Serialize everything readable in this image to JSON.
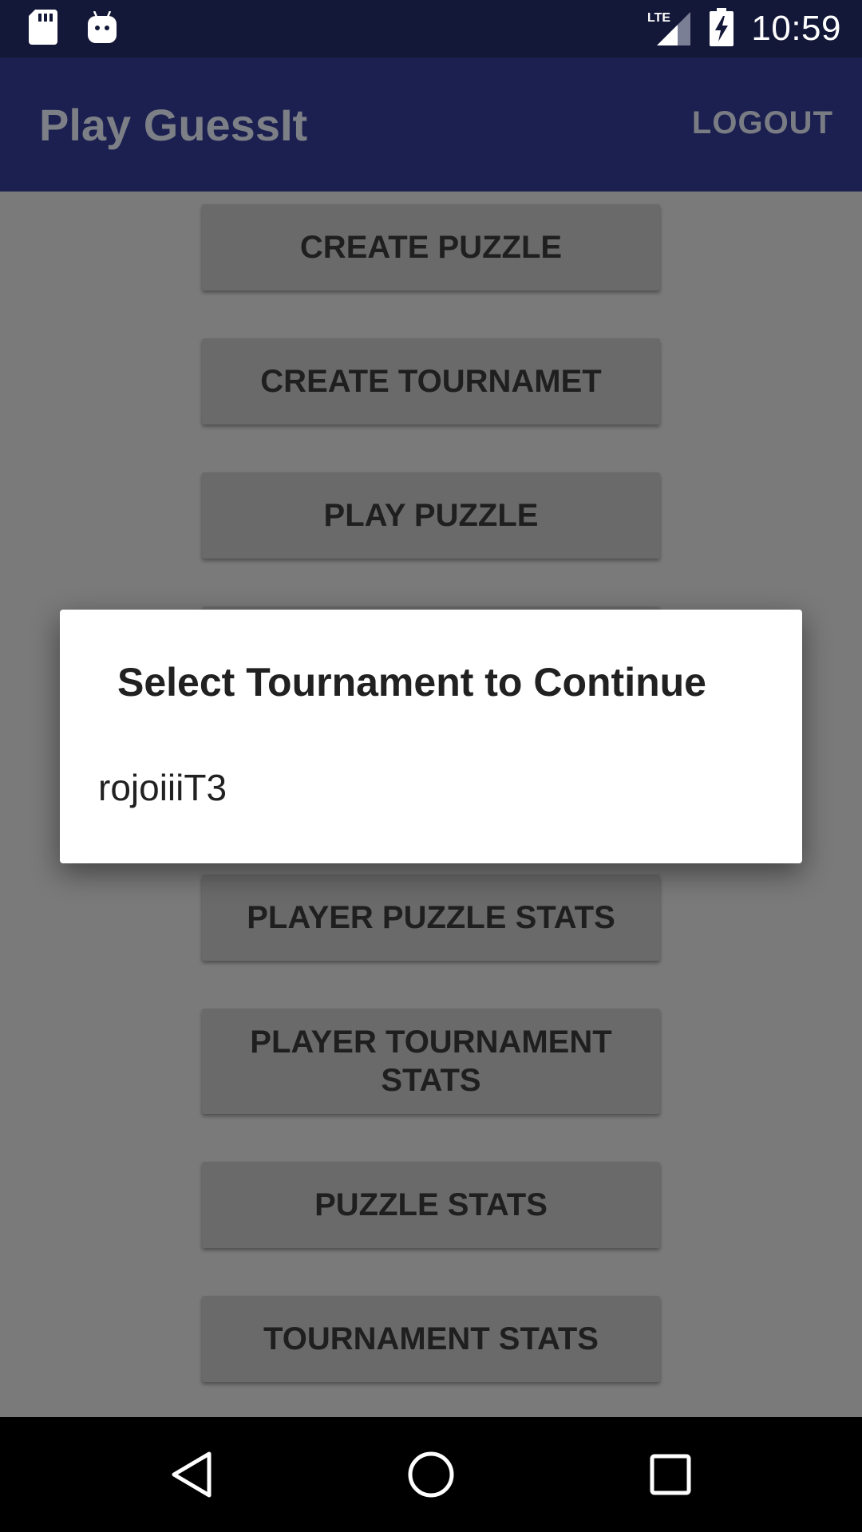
{
  "status_bar": {
    "time": "10:59",
    "network": "LTE",
    "icons": [
      "sd-card-icon",
      "android-icon",
      "lte-signal-icon",
      "battery-charging-icon"
    ]
  },
  "app_bar": {
    "title": "Play GuessIt",
    "logout_label": "LOGOUT"
  },
  "menu": {
    "buttons": [
      "CREATE PUZZLE",
      "CREATE TOURNAMET",
      "PLAY PUZZLE",
      "",
      "",
      "PLAYER PUZZLE STATS",
      "PLAYER TOURNAMENT STATS",
      "PUZZLE STATS",
      "TOURNAMENT STATS"
    ]
  },
  "dialog": {
    "title": "Select Tournament to Continue",
    "items": [
      "rojoiiiT3"
    ]
  },
  "nav_bar": {
    "icons": [
      "back-icon",
      "home-icon",
      "recents-icon"
    ]
  },
  "colors": {
    "status_bar_bg": "#141838",
    "app_bar_bg": "#1b2050",
    "scrim_bg": "#7a7a7a",
    "button_bg": "#6a6a6a",
    "dialog_bg": "#ffffff"
  }
}
